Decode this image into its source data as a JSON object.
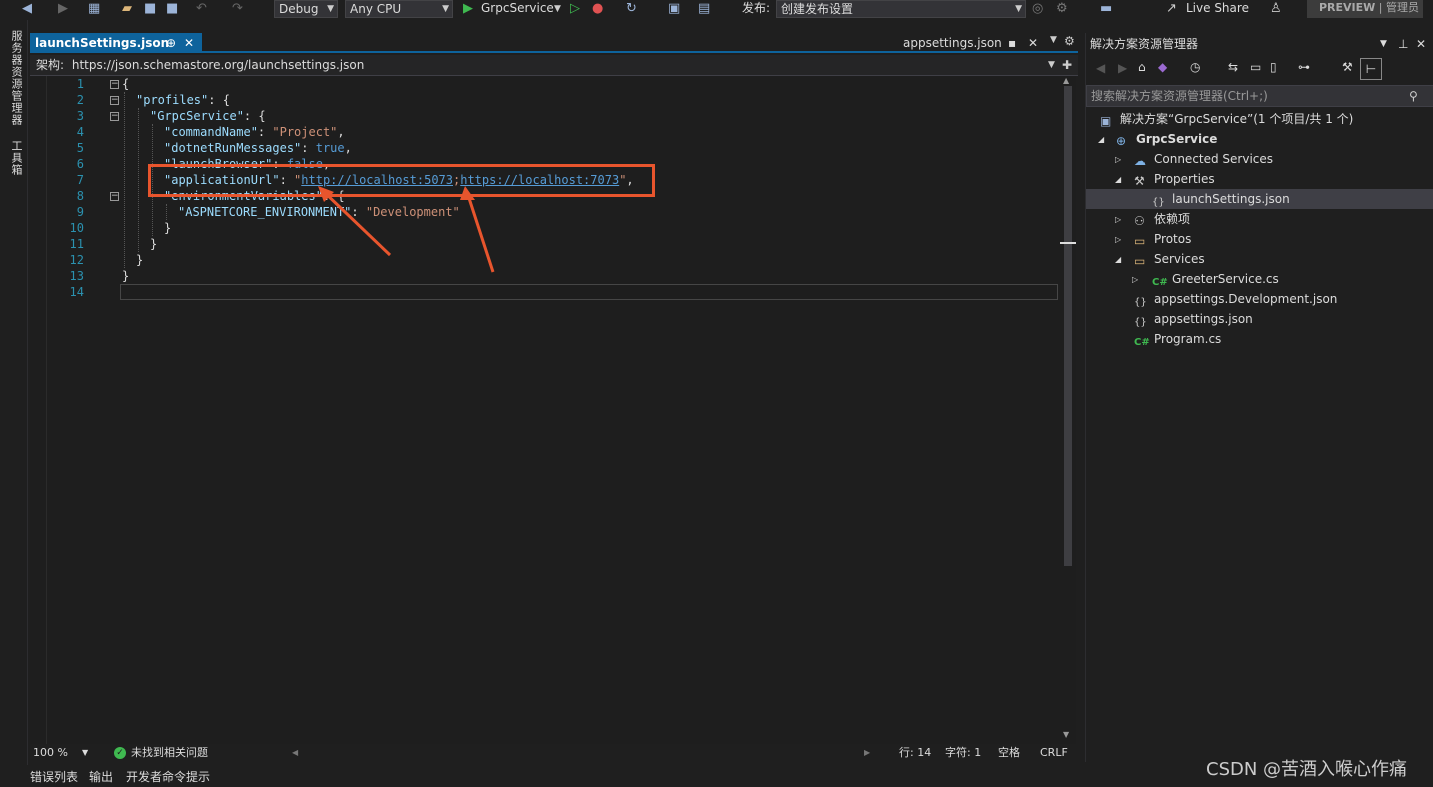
{
  "toolbar": {
    "config": "Debug",
    "platform": "Any CPU",
    "run_target": "GrpcService",
    "publish_label": "发布:",
    "publish_value": "创建发布设置",
    "live_share": "Live Share",
    "preview": "PREVIEW",
    "admin": "管理员"
  },
  "left_strip": {
    "server_explorer": "服务器资源管理器",
    "toolbox": "工具箱"
  },
  "editor": {
    "active_tab": "launchSettings.json",
    "other_tab": "appsettings.json",
    "schema_label": "架构:",
    "schema_url": "https://json.schemastore.org/launchsettings.json",
    "line_numbers": [
      "1",
      "2",
      "3",
      "4",
      "5",
      "6",
      "7",
      "8",
      "9",
      "10",
      "11",
      "12",
      "13",
      "14"
    ],
    "code": {
      "l1": "{",
      "l2_key": "\"profiles\"",
      "l2_rest": ": {",
      "l3_key": "\"GrpcService\"",
      "l3_rest": ": {",
      "l4_key": "\"commandName\"",
      "l4_val": "\"Project\"",
      "l5_key": "\"dotnetRunMessages\"",
      "l5_val": "true",
      "l6_key": "\"launchBrowser\"",
      "l6_val": "false",
      "l7_key": "\"applicationUrl\"",
      "l7_url1": "http://localhost:5073",
      "l7_url2": "https://localhost:7073",
      "l8_key": "\"environmentVariables\"",
      "l8_rest": ": {",
      "l9_key": "\"ASPNETCORE_ENVIRONMENT\"",
      "l9_val": "\"Development\"",
      "l10": "}",
      "l11": "}",
      "l12": "}",
      "l13": "}"
    }
  },
  "status": {
    "zoom": "100 %",
    "issues": "未找到相关问题",
    "line": "行: 14",
    "col": "字符: 1",
    "ws": "空格",
    "eol": "CRLF"
  },
  "bottom_tabs": [
    "错误列表",
    "输出",
    "开发者命令提示"
  ],
  "solution_explorer": {
    "title": "解决方案资源管理器",
    "search_placeholder": "搜索解决方案资源管理器(Ctrl+;)",
    "solution": "解决方案“GrpcService”(1 个项目/共 1 个)",
    "project": "GrpcService",
    "items": {
      "connected": "Connected Services",
      "properties": "Properties",
      "launch": "launchSettings.json",
      "deps": "依赖项",
      "protos": "Protos",
      "services": "Services",
      "greeter": "GreeterService.cs",
      "appdev": "appsettings.Development.json",
      "app": "appsettings.json",
      "program": "Program.cs"
    }
  },
  "watermark": "CSDN @苦酒入喉心作痛",
  "colors": {
    "accent": "#0e639c",
    "highlight": "#e8552d"
  }
}
